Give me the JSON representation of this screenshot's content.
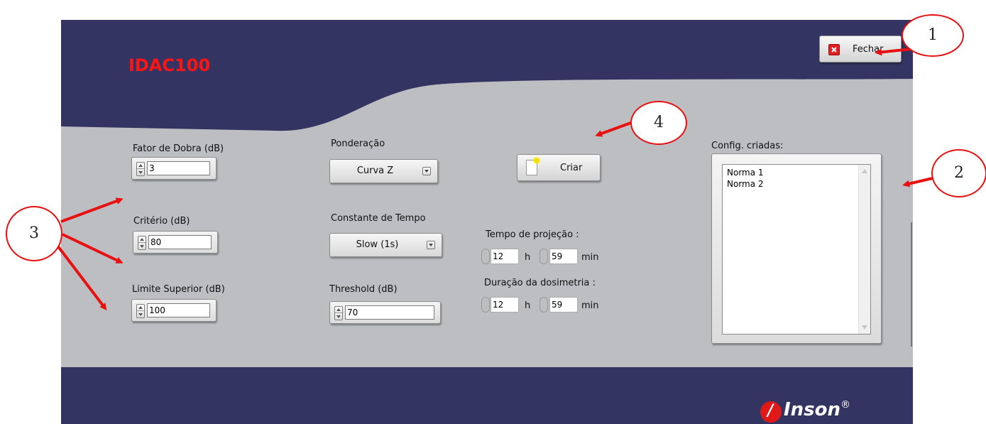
{
  "app": {
    "title": "IDAC100",
    "brand": "Inson",
    "brand_mark": "®"
  },
  "colors": {
    "navy": "#343462",
    "panel": "#bdbec2",
    "title_red": "#ff1414",
    "annotation_red": "#e81010"
  },
  "close_button": {
    "label": "Fechar",
    "icon": "close-x-icon"
  },
  "fator_dobra": {
    "label": "Fator de Dobra (dB)",
    "value": "3"
  },
  "criterio": {
    "label": "Critério (dB)",
    "value": "80"
  },
  "limite_superior": {
    "label": "Limite Superior (dB)",
    "value": "100"
  },
  "ponderacao": {
    "label": "Ponderação",
    "value": "Curva Z"
  },
  "constante_tempo": {
    "label": "Constante de Tempo",
    "value": "Slow (1s)"
  },
  "threshold": {
    "label": "Threshold (dB)",
    "value": "70"
  },
  "criar_button": {
    "label": "Criar",
    "icon": "new-document-icon"
  },
  "tempo_projecao": {
    "label": "Tempo de projeção :",
    "hours": "12",
    "h_unit": "h",
    "minutes": "59",
    "min_unit": "min"
  },
  "duracao_dosimetria": {
    "label": "Duração da dosimetria :",
    "hours": "12",
    "h_unit": "h",
    "minutes": "59",
    "min_unit": "min"
  },
  "config_criadas": {
    "label": "Config. criadas:",
    "items": [
      "Norma 1",
      "Norma 2"
    ]
  },
  "callouts": [
    "1",
    "2",
    "3",
    "4"
  ]
}
